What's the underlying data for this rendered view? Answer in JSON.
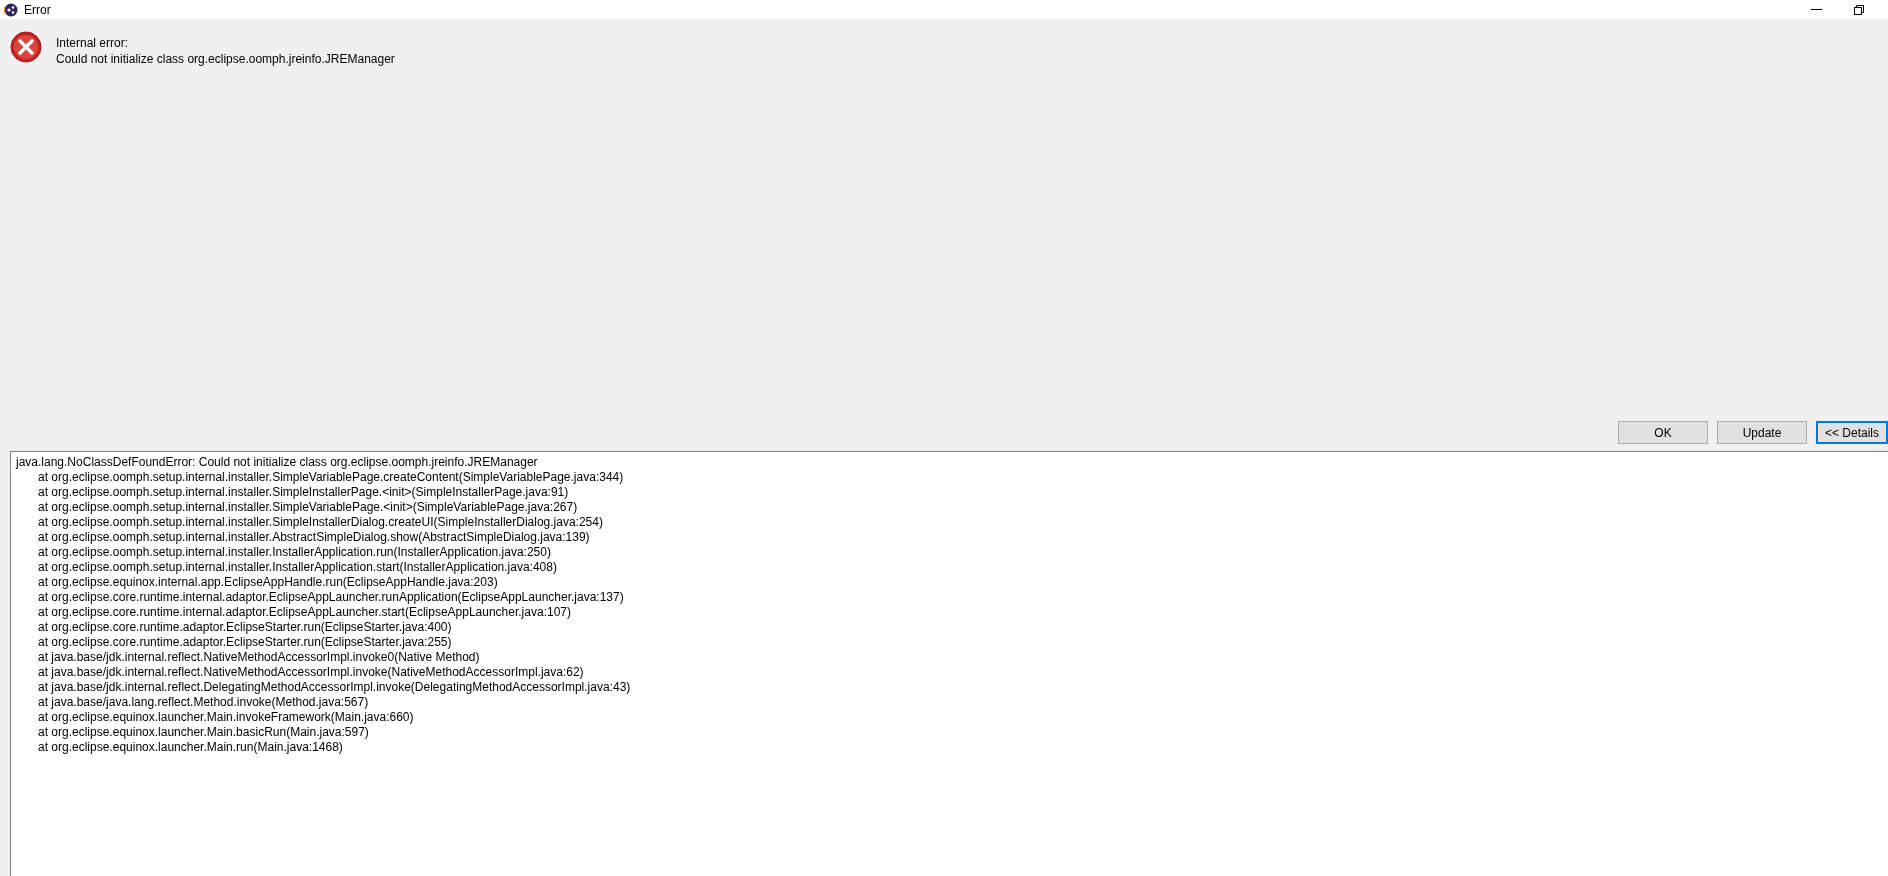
{
  "window": {
    "title": "Error"
  },
  "message": {
    "lines": [
      "Internal error:",
      "Could not initialize class org.eclipse.oomph.jreinfo.JREManager"
    ]
  },
  "buttons": [
    {
      "label": "OK",
      "focused": false
    },
    {
      "label": "Update",
      "focused": false
    },
    {
      "label": "<< Details",
      "focused": true
    }
  ],
  "details": {
    "exception": "java.lang.NoClassDefFoundError: Could not initialize class org.eclipse.oomph.jreinfo.JREManager",
    "frames": [
      "at org.eclipse.oomph.setup.internal.installer.SimpleVariablePage.createContent(SimpleVariablePage.java:344)",
      "at org.eclipse.oomph.setup.internal.installer.SimpleInstallerPage.<init>(SimpleInstallerPage.java:91)",
      "at org.eclipse.oomph.setup.internal.installer.SimpleVariablePage.<init>(SimpleVariablePage.java:267)",
      "at org.eclipse.oomph.setup.internal.installer.SimpleInstallerDialog.createUI(SimpleInstallerDialog.java:254)",
      "at org.eclipse.oomph.setup.internal.installer.AbstractSimpleDialog.show(AbstractSimpleDialog.java:139)",
      "at org.eclipse.oomph.setup.internal.installer.InstallerApplication.run(InstallerApplication.java:250)",
      "at org.eclipse.oomph.setup.internal.installer.InstallerApplication.start(InstallerApplication.java:408)",
      "at org.eclipse.equinox.internal.app.EclipseAppHandle.run(EclipseAppHandle.java:203)",
      "at org.eclipse.core.runtime.internal.adaptor.EclipseAppLauncher.runApplication(EclipseAppLauncher.java:137)",
      "at org.eclipse.core.runtime.internal.adaptor.EclipseAppLauncher.start(EclipseAppLauncher.java:107)",
      "at org.eclipse.core.runtime.adaptor.EclipseStarter.run(EclipseStarter.java:400)",
      "at org.eclipse.core.runtime.adaptor.EclipseStarter.run(EclipseStarter.java:255)",
      "at java.base/jdk.internal.reflect.NativeMethodAccessorImpl.invoke0(Native Method)",
      "at java.base/jdk.internal.reflect.NativeMethodAccessorImpl.invoke(NativeMethodAccessorImpl.java:62)",
      "at java.base/jdk.internal.reflect.DelegatingMethodAccessorImpl.invoke(DelegatingMethodAccessorImpl.java:43)",
      "at java.base/java.lang.reflect.Method.invoke(Method.java:567)",
      "at org.eclipse.equinox.launcher.Main.invokeFramework(Main.java:660)",
      "at org.eclipse.equinox.launcher.Main.basicRun(Main.java:597)",
      "at org.eclipse.equinox.launcher.Main.run(Main.java:1468)"
    ]
  }
}
